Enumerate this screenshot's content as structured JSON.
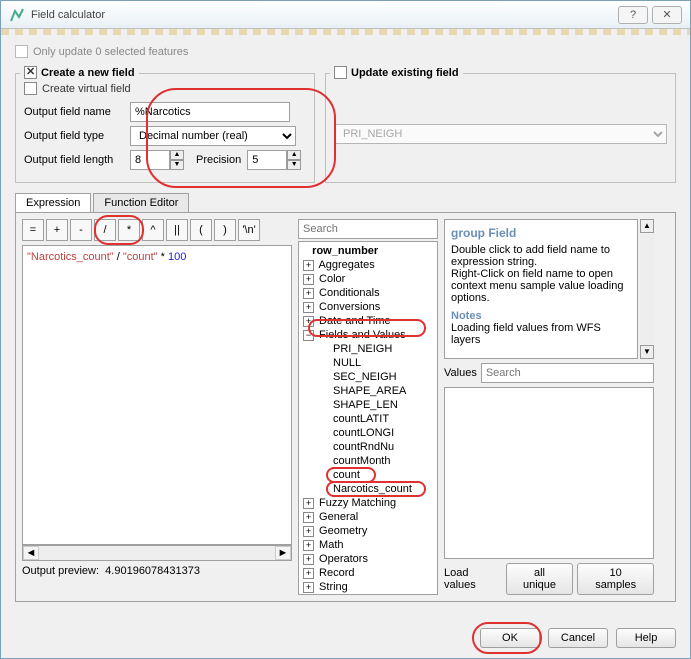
{
  "title": "Field calculator",
  "only_update": "Only update 0 selected features",
  "create_field_legend": "Create a new field",
  "update_field_legend": "Update existing field",
  "create_virtual": "Create virtual field",
  "lbl_name": "Output field name",
  "lbl_type": "Output field type",
  "lbl_length": "Output field length",
  "lbl_precision": "Precision",
  "val_name": "%Narcotics",
  "val_type": "Decimal number (real)",
  "val_length": "8",
  "val_precision": "5",
  "update_field_select": "PRI_NEIGH",
  "tab_expression": "Expression",
  "tab_function": "Function Editor",
  "ops": [
    "=",
    "+",
    "-",
    "/",
    "*",
    "^",
    "||",
    "(",
    ")",
    "'\\n'"
  ],
  "expr_part1": "\"Narcotics_count\"",
  "expr_op1": " / ",
  "expr_part2": "\"count\"",
  "expr_op2": " * ",
  "expr_num": "100",
  "preview_label": "Output preview:",
  "preview_value": "4.90196078431373",
  "search_placeholder": "Search",
  "tree": {
    "top": "row_number",
    "groups": [
      "Aggregates",
      "Color",
      "Conditionals",
      "Conversions",
      "Date and Time"
    ],
    "fv": "Fields and Values",
    "fields": [
      "PRI_NEIGH",
      "NULL",
      "SEC_NEIGH",
      "SHAPE_AREA",
      "SHAPE_LEN",
      "countLATIT",
      "countLONGI",
      "countRndNu",
      "countMonth",
      "count",
      "Narcotics_count"
    ],
    "groups2": [
      "Fuzzy Matching",
      "General",
      "Geometry",
      "Math",
      "Operators",
      "Record",
      "String"
    ]
  },
  "help": {
    "title": "group Field",
    "text1": "Double click to add field name to expression string.",
    "text2": "Right-Click on field name to open context menu sample value loading options.",
    "notes": "Notes",
    "text3": "Loading field values from WFS layers"
  },
  "values_label": "Values",
  "load_values": "Load values",
  "all_unique": "all unique",
  "ten_samples": "10 samples",
  "ok": "OK",
  "cancel": "Cancel",
  "helpbtn": "Help"
}
